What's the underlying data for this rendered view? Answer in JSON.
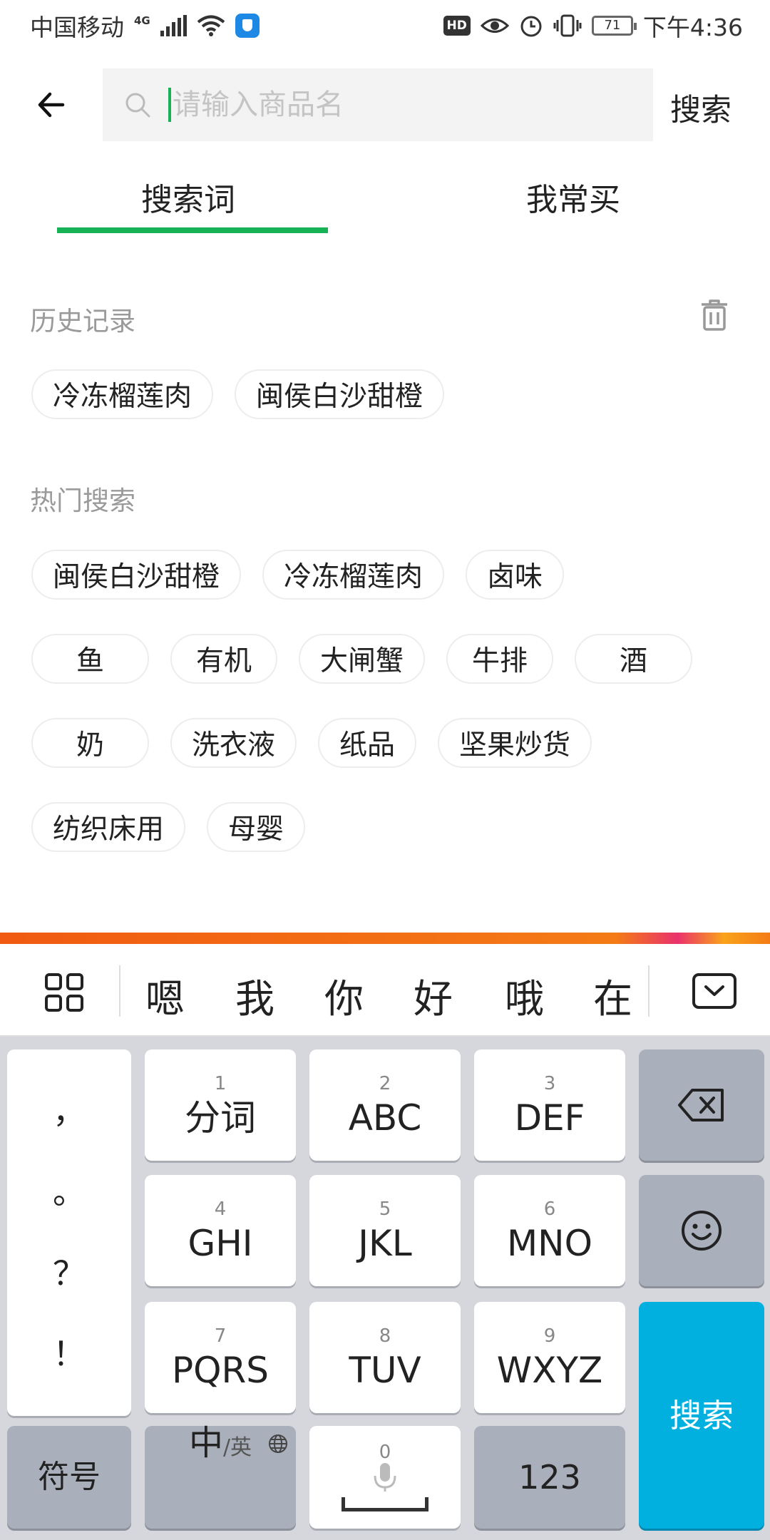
{
  "status_bar": {
    "carrier": "中国移动",
    "network": "4G",
    "hd": "HD",
    "battery": "71",
    "time": "下午4:36"
  },
  "header": {
    "placeholder": "请输入商品名",
    "search_label": "搜索"
  },
  "tabs": [
    {
      "label": "搜索词",
      "active": true
    },
    {
      "label": "我常买",
      "active": false
    }
  ],
  "history": {
    "title": "历史记录",
    "items": [
      "冷冻榴莲肉",
      "闽侯白沙甜橙"
    ]
  },
  "hot": {
    "title": "热门搜索",
    "rows": [
      [
        "闽侯白沙甜橙",
        "冷冻榴莲肉",
        "卤味"
      ],
      [
        "鱼",
        "有机",
        "大闸蟹",
        "牛排",
        "酒"
      ],
      [
        "奶",
        "洗衣液",
        "纸品",
        "坚果炒货"
      ],
      [
        "纺织床用",
        "母婴"
      ]
    ]
  },
  "candidates": [
    "嗯",
    "我",
    "你",
    "好",
    "哦",
    "在"
  ],
  "keyboard": {
    "punct": [
      "，",
      "。",
      "？",
      "！"
    ],
    "keys": [
      {
        "num": "1",
        "label": "分词"
      },
      {
        "num": "2",
        "label": "ABC"
      },
      {
        "num": "3",
        "label": "DEF"
      },
      {
        "num": "4",
        "label": "GHI"
      },
      {
        "num": "5",
        "label": "JKL"
      },
      {
        "num": "6",
        "label": "MNO"
      },
      {
        "num": "7",
        "label": "PQRS"
      },
      {
        "num": "8",
        "label": "TUV"
      },
      {
        "num": "9",
        "label": "WXYZ"
      }
    ],
    "symbols": "符号",
    "lang_main": "中",
    "lang_sub": "/英",
    "space_num": "0",
    "num_key": "123",
    "search_key": "搜索"
  },
  "colors": {
    "accent_green": "#17b255",
    "keyboard_search_blue": "#02b0e0",
    "keyboard_bg": "#d5d7dd"
  }
}
